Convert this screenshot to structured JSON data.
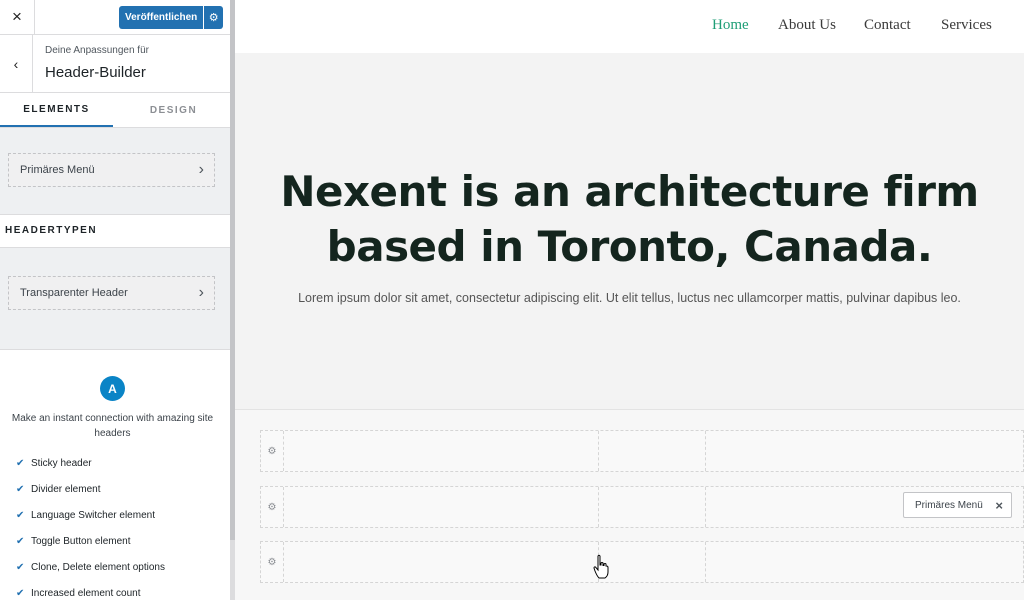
{
  "sidebar": {
    "close_icon": "×",
    "publish_label": "Veröffentlichen",
    "publish_settings_icon": "⚙",
    "back_icon": "‹",
    "breadcrumb_small": "Deine Anpassungen für",
    "breadcrumb_title": "Header-Builder",
    "tabs": [
      {
        "label": "ELEMENTS",
        "active": true
      },
      {
        "label": "DESIGN",
        "active": false
      }
    ],
    "primary_menu_item": "Primäres Menü",
    "section_header_types": "HEADERTYPEN",
    "transparent_header_item": "Transparenter Header",
    "promo": {
      "logo_letter": "A",
      "text": "Make an instant connection with amazing site headers",
      "features": [
        "Sticky header",
        "Divider element",
        "Language Switcher element",
        "Toggle Button element",
        "Clone, Delete element options",
        "Increased element count"
      ]
    }
  },
  "preview": {
    "nav": [
      {
        "label": "Home",
        "active": true
      },
      {
        "label": "About Us",
        "active": false
      },
      {
        "label": "Contact",
        "active": false
      },
      {
        "label": "Services",
        "active": false
      }
    ],
    "hero_title_line1": "Nexent is an architecture firm",
    "hero_title_line2": "based in Toronto, Canada.",
    "hero_text": "Lorem ipsum dolor sit amet, consectetur adipiscing elit. Ut elit tellus, luctus nec ullamcorper mattis, pulvinar dapibus leo.",
    "builder": {
      "row_gear_icon": "⚙",
      "chip_label": "Primäres Menü",
      "chip_close": "×"
    }
  },
  "colors": {
    "accent": "#2271b1",
    "nav_active": "#1e9e76",
    "hero_title": "#14251e",
    "logo": "#0a84c6"
  }
}
